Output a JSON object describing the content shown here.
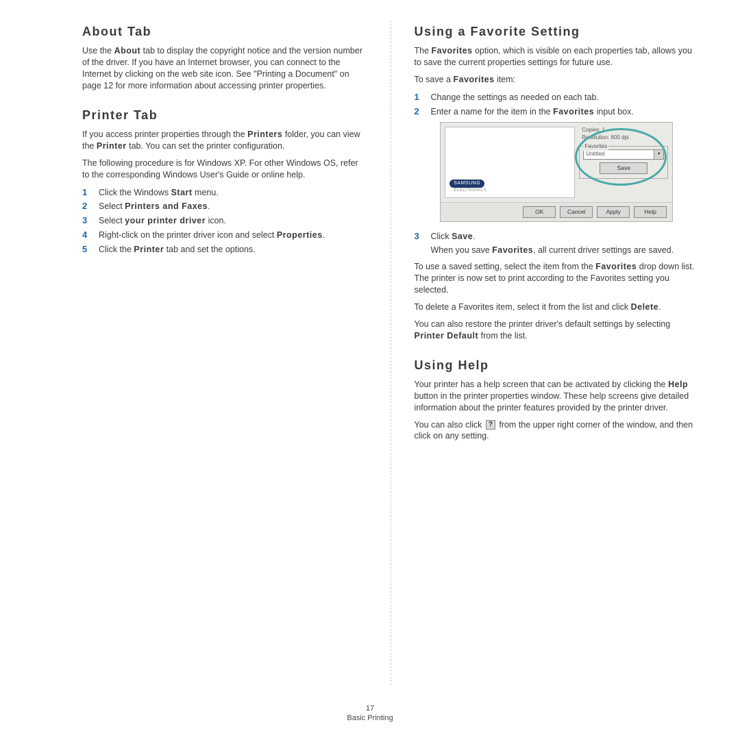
{
  "left": {
    "about": {
      "heading": "About Tab",
      "p1a": "Use the ",
      "p1b": "About",
      "p1c": " tab to display the copyright notice and the version number of the driver. If you have an Internet browser, you can connect to the Internet by clicking on the web site icon. See \"Printing a Document\" on page 12 for more information about accessing printer properties."
    },
    "printer": {
      "heading": "Printer Tab",
      "p1a": "If you access printer properties through the ",
      "p1b": "Printers",
      "p1c": " folder, you can view the ",
      "p1d": "Printer",
      "p1e": " tab. You can set the printer configuration.",
      "p2": "The following procedure is for Windows XP. For other Windows OS, refer to the corresponding Windows User's Guide or online help.",
      "steps": {
        "s1a": "Click the Windows ",
        "s1b": "Start",
        "s1c": " menu.",
        "s2a": "Select ",
        "s2b": "Printers and Faxes",
        "s2c": ".",
        "s3a": "Select ",
        "s3b": "your printer driver",
        "s3c": " icon.",
        "s4a": "Right-click on the printer driver icon and select ",
        "s4b": "Properties",
        "s4c": ".",
        "s5a": "Click the ",
        "s5b": "Printer",
        "s5c": " tab and set the options."
      }
    }
  },
  "right": {
    "fav": {
      "heading": "Using a Favorite Setting",
      "p1a": "The ",
      "p1b": "Favorites",
      "p1c": " option, which is visible on each properties tab, allows you to save the current properties settings for future use.",
      "p2a": "To save a ",
      "p2b": "Favorites",
      "p2c": " item:",
      "s1": "Change the settings as needed on each tab.",
      "s2a": "Enter a name for the item in the ",
      "s2b": "Favorites",
      "s2c": " input box.",
      "shot": {
        "copies": "Copies: 1",
        "resolution": "Resolution: 600 dpi",
        "fav_label": "Favorites",
        "combo_value": "Untitled",
        "save": "Save",
        "brand": "SAMSUNG",
        "elec": "ELECTRONICS",
        "ok": "OK",
        "cancel": "Cancel",
        "apply": "Apply",
        "help": "Help"
      },
      "s3a": "Click ",
      "s3b": "Save",
      "s3c": ".",
      "s3_sub_a": "When you save ",
      "s3_sub_b": "Favorites",
      "s3_sub_c": ", all current driver settings are saved.",
      "p3a": "To use a saved setting, select the item from the ",
      "p3b": "Favorites",
      "p3c": " drop down list. The printer is now set to print according to the Favorites setting you selected.",
      "p4a": "To delete a Favorites item, select it from the list and click ",
      "p4b": "Delete",
      "p4c": ".",
      "p5a": "You can also restore the printer driver's default settings by selecting ",
      "p5b": "Printer Default",
      "p5c": " from the list."
    },
    "help": {
      "heading": "Using Help",
      "p1a": "Your printer has a help screen that can be activated by clicking the ",
      "p1b": "Help",
      "p1c": " button in the printer properties window. These help screens give detailed information about the printer features provided by the printer driver.",
      "p2a": "You can also click ",
      "p2b": " from the upper right corner of the window, and then click on any setting."
    }
  },
  "nums": {
    "n1": "1",
    "n2": "2",
    "n3": "3",
    "n4": "4",
    "n5": "5"
  },
  "footer": {
    "page": "17",
    "section": "Basic Printing"
  },
  "icons": {
    "question": "?",
    "dropdown": "▼"
  }
}
